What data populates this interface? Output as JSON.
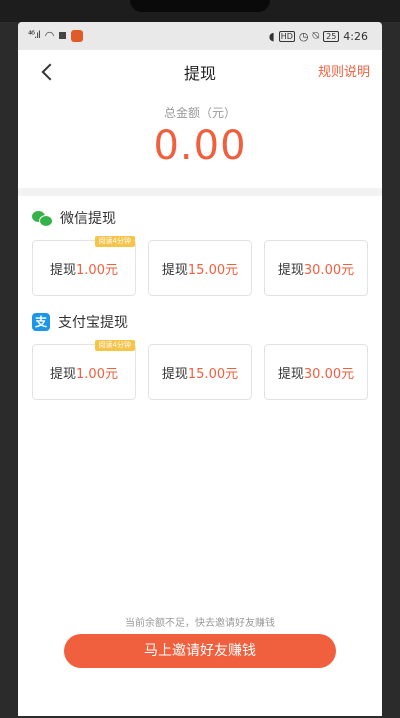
{
  "status_bar": {
    "signal": "⁴⁶.ıl",
    "time": "4:26",
    "hd": "HD",
    "battery": "25"
  },
  "header": {
    "title": "提现",
    "rules_link": "规则说明"
  },
  "balance": {
    "label": "总金额（元）",
    "amount": "0.00"
  },
  "wechat": {
    "title": "微信提现",
    "options": [
      {
        "prefix": "提现",
        "amount": "1.00元",
        "tag": "阅读4分钟"
      },
      {
        "prefix": "提现",
        "amount": "15.00元"
      },
      {
        "prefix": "提现",
        "amount": "30.00元"
      }
    ]
  },
  "alipay": {
    "title": "支付宝提现",
    "icon_glyph": "支",
    "options": [
      {
        "prefix": "提现",
        "amount": "1.00元",
        "tag": "阅读4分钟"
      },
      {
        "prefix": "提现",
        "amount": "15.00元"
      },
      {
        "prefix": "提现",
        "amount": "30.00元"
      }
    ]
  },
  "footer": {
    "hint": "当前余额不足，快去邀请好友赚钱",
    "invite_button": "马上邀请好友赚钱"
  },
  "colors": {
    "accent": "#f0603e",
    "wechat_green": "#35b34a",
    "alipay_blue": "#1c97e8",
    "tag_yellow": "#f7c44a"
  }
}
